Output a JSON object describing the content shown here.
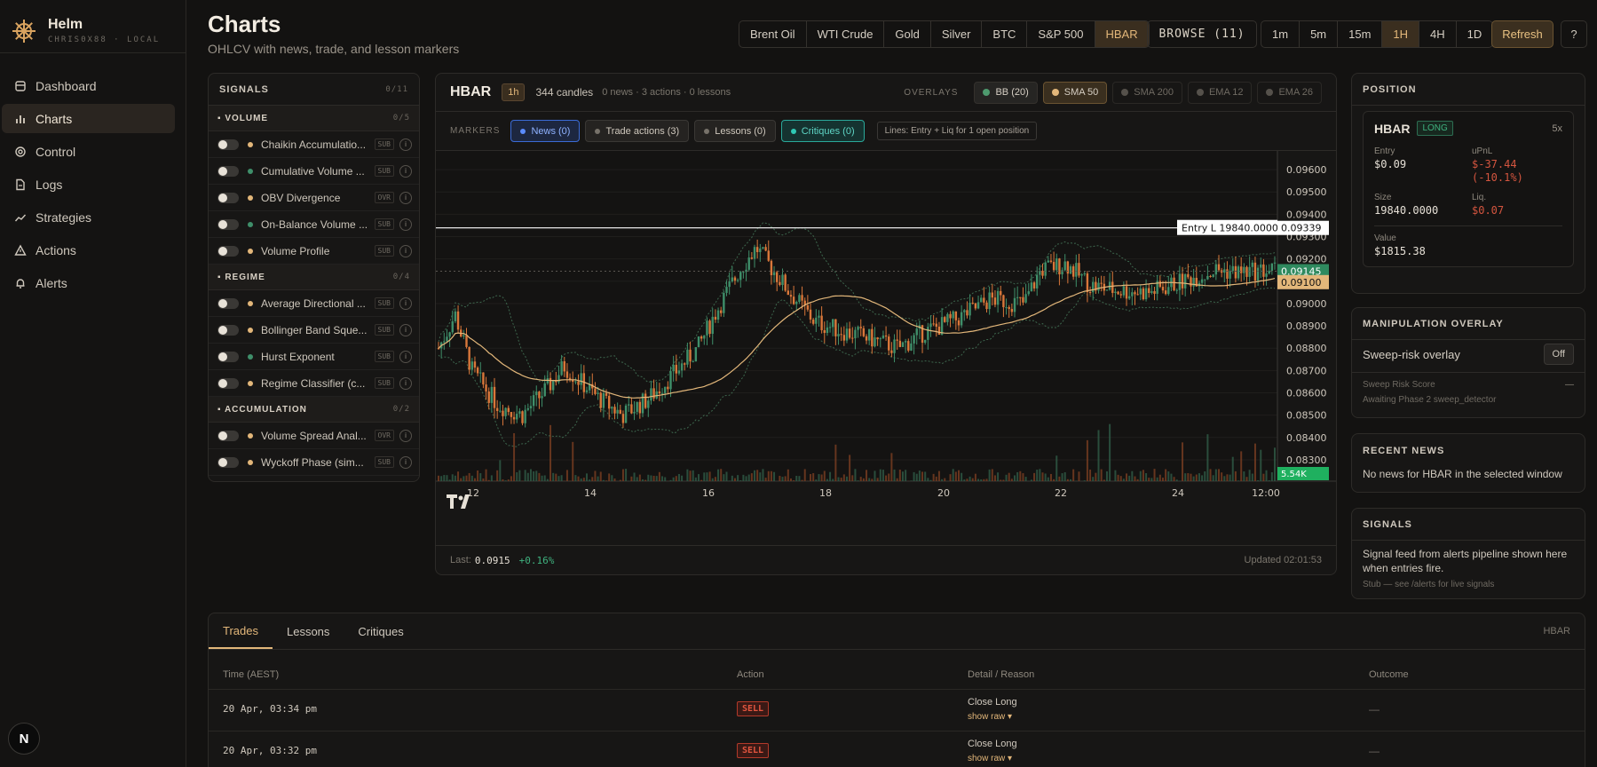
{
  "brand": {
    "name": "Helm",
    "sub": "CHRIS0X88 · LOCAL"
  },
  "nav": [
    {
      "label": "Dashboard",
      "icon": "dashboard-icon"
    },
    {
      "label": "Charts",
      "icon": "bar-chart-icon",
      "active": true
    },
    {
      "label": "Control",
      "icon": "gear-icon"
    },
    {
      "label": "Logs",
      "icon": "file-icon"
    },
    {
      "label": "Strategies",
      "icon": "trend-icon"
    },
    {
      "label": "Actions",
      "icon": "alert-triangle-icon"
    },
    {
      "label": "Alerts",
      "icon": "bell-icon"
    }
  ],
  "avatar": "N",
  "header": {
    "title": "Charts",
    "subtitle": "OHLCV with news, trade, and lesson markers"
  },
  "assets": [
    "Brent Oil",
    "WTI Crude",
    "Gold",
    "Silver",
    "BTC",
    "S&P 500",
    "HBAR"
  ],
  "asset_active": "HBAR",
  "browse": "BROWSE (11)",
  "timeframes": [
    "1m",
    "5m",
    "15m",
    "1H",
    "4H",
    "1D"
  ],
  "timeframe_active": "1H",
  "refresh": "Refresh",
  "help": "?",
  "signals": {
    "title": "SIGNALS",
    "count": "0/11",
    "groups": [
      {
        "name": "VOLUME",
        "count": "0/5",
        "items": [
          {
            "name": "Chaikin Accumulatio...",
            "tag": "SUB",
            "color": "#e3b77a"
          },
          {
            "name": "Cumulative Volume ...",
            "tag": "SUB",
            "color": "#3f8f6a"
          },
          {
            "name": "OBV Divergence",
            "tag": "OVR",
            "color": "#e3b77a"
          },
          {
            "name": "On-Balance Volume ...",
            "tag": "SUB",
            "color": "#3f8f6a"
          },
          {
            "name": "Volume Profile",
            "tag": "SUB",
            "color": "#e3b77a"
          }
        ]
      },
      {
        "name": "REGIME",
        "count": "0/4",
        "items": [
          {
            "name": "Average Directional ...",
            "tag": "SUB",
            "color": "#e3b77a"
          },
          {
            "name": "Bollinger Band Sque...",
            "tag": "SUB",
            "color": "#e3b77a"
          },
          {
            "name": "Hurst Exponent",
            "tag": "SUB",
            "color": "#3f8f6a"
          },
          {
            "name": "Regime Classifier (c...",
            "tag": "SUB",
            "color": "#e3b77a"
          }
        ]
      },
      {
        "name": "ACCUMULATION",
        "count": "0/2",
        "items": [
          {
            "name": "Volume Spread Anal...",
            "tag": "OVR",
            "color": "#e3b77a"
          },
          {
            "name": "Wyckoff Phase (sim...",
            "tag": "SUB",
            "color": "#e3b77a"
          }
        ]
      }
    ]
  },
  "chart": {
    "symbol": "HBAR",
    "tf": "1h",
    "candles": "344 candles",
    "meta": "0 news · 3 actions · 0 lessons",
    "overlays_label": "OVERLAYS",
    "overlays": [
      {
        "label": "BB (20)",
        "state": "on-bb",
        "color": "#4e9a6e"
      },
      {
        "label": "SMA 50",
        "state": "on-sma",
        "color": "#e3b77a"
      },
      {
        "label": "SMA 200",
        "state": "off",
        "color": "#55514b"
      },
      {
        "label": "EMA 12",
        "state": "off",
        "color": "#55514b"
      },
      {
        "label": "EMA 26",
        "state": "off",
        "color": "#55514b"
      }
    ],
    "markers_label": "MARKERS",
    "markers": [
      {
        "label": "News (0)",
        "cls": "news",
        "color": "#5b8cff"
      },
      {
        "label": "Trade actions (3)",
        "cls": "",
        "color": "#77726a"
      },
      {
        "label": "Lessons (0)",
        "cls": "",
        "color": "#77726a"
      },
      {
        "label": "Critiques (0)",
        "cls": "crit",
        "color": "#2fc9b4"
      }
    ],
    "lines_note": "Lines: Entry + Liq for 1 open position",
    "entry_label": "Entry L 19840.0000",
    "entry_price": "0.09339",
    "last_price_tag": "0.09145",
    "sma_tag": "0.09100",
    "volume_tag": "5.54K",
    "footer": {
      "last_label": "Last:",
      "last": "0.0915",
      "change": "+0.16%",
      "updated": "Updated 02:01:53"
    }
  },
  "chart_data": {
    "type": "candlestick",
    "y_ticks": [
      "0.09600",
      "0.09500",
      "0.09400",
      "0.09300",
      "0.09200",
      "0.09100",
      "0.09000",
      "0.08900",
      "0.08800",
      "0.08700",
      "0.08600",
      "0.08500",
      "0.08400",
      "0.08300"
    ],
    "x_ticks": [
      "12",
      "14",
      "16",
      "18",
      "20",
      "22",
      "24",
      "12:00"
    ],
    "ylim": [
      0.0826,
      0.0966
    ],
    "entry": 0.09339,
    "last": 0.09145,
    "sma50_last": 0.091,
    "overlays": [
      "BB (20)",
      "SMA 50"
    ],
    "close_path": [
      [
        0,
        0.088
      ],
      [
        0.02,
        0.0895
      ],
      [
        0.04,
        0.087
      ],
      [
        0.07,
        0.0855
      ],
      [
        0.1,
        0.085
      ],
      [
        0.13,
        0.0862
      ],
      [
        0.15,
        0.0872
      ],
      [
        0.17,
        0.0865
      ],
      [
        0.19,
        0.0858
      ],
      [
        0.22,
        0.085
      ],
      [
        0.25,
        0.0857
      ],
      [
        0.28,
        0.0868
      ],
      [
        0.31,
        0.088
      ],
      [
        0.33,
        0.0895
      ],
      [
        0.36,
        0.0915
      ],
      [
        0.38,
        0.0925
      ],
      [
        0.42,
        0.0905
      ],
      [
        0.45,
        0.0892
      ],
      [
        0.48,
        0.0888
      ],
      [
        0.51,
        0.0885
      ],
      [
        0.55,
        0.088
      ],
      [
        0.58,
        0.0887
      ],
      [
        0.62,
        0.0893
      ],
      [
        0.66,
        0.0902
      ],
      [
        0.7,
        0.09
      ],
      [
        0.72,
        0.0915
      ],
      [
        0.75,
        0.0918
      ],
      [
        0.78,
        0.0908
      ],
      [
        0.81,
        0.0906
      ],
      [
        0.85,
        0.0905
      ],
      [
        0.89,
        0.091
      ],
      [
        0.93,
        0.0915
      ],
      [
        0.96,
        0.0914
      ],
      [
        1.0,
        0.0915
      ]
    ]
  },
  "position": {
    "title": "POSITION",
    "symbol": "HBAR",
    "side": "LONG",
    "leverage": "5x",
    "entry_label": "Entry",
    "entry": "$0.09",
    "upnl_label": "uPnL",
    "upnl": "$-37.44",
    "upnl_pct": "(-10.1%)",
    "size_label": "Size",
    "size": "19840.0000",
    "liq_label": "Liq.",
    "liq": "$0.07",
    "value_label": "Value",
    "value": "$1815.38"
  },
  "manipulation": {
    "title": "MANIPULATION OVERLAY",
    "label": "Sweep-risk overlay",
    "button": "Off",
    "score_label": "Sweep Risk Score",
    "score": "—",
    "note": "Awaiting Phase 2 sweep_detector"
  },
  "news": {
    "title": "RECENT NEWS",
    "text": "No news for HBAR in the selected window"
  },
  "signals_panel": {
    "title": "SIGNALS",
    "text": "Signal feed from alerts pipeline shown here when entries fire.",
    "note": "Stub — see /alerts for live signals"
  },
  "bottom": {
    "tabs": [
      "Trades",
      "Lessons",
      "Critiques"
    ],
    "active": "Trades",
    "symbol": "HBAR",
    "columns": [
      "Time (AEST)",
      "Action",
      "Detail / Reason",
      "Outcome"
    ],
    "rows": [
      {
        "time": "20 Apr, 03:34 pm",
        "action": "SELL",
        "detail": "Close Long",
        "raw": "show raw ▾",
        "outcome": "—"
      },
      {
        "time": "20 Apr, 03:32 pm",
        "action": "SELL",
        "detail": "Close Long",
        "raw": "show raw ▾",
        "outcome": "—"
      }
    ]
  }
}
